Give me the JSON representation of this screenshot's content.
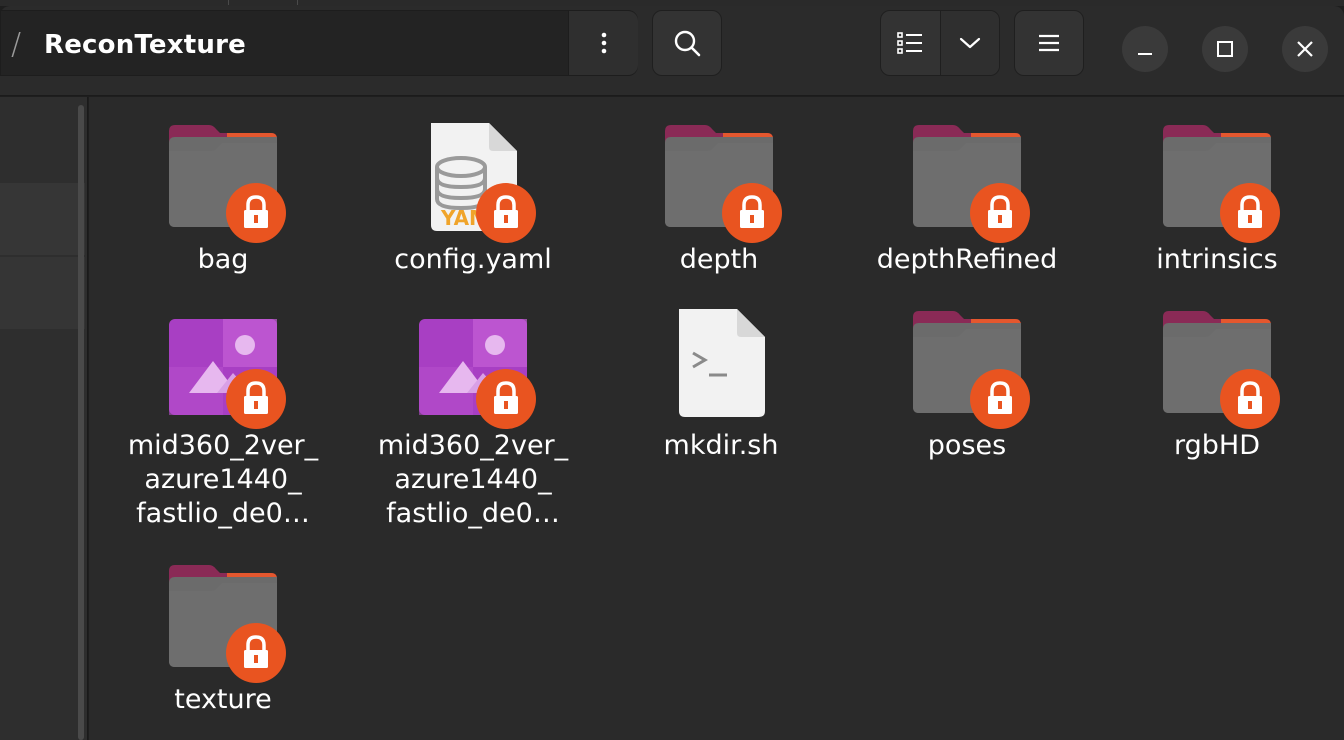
{
  "header": {
    "path_separator": "/",
    "current_folder": "ReconTexture",
    "icons": {
      "path_menu": "vertical-dots-icon",
      "search": "search-icon",
      "list_view": "list-view-icon",
      "view_options": "chevron-down-icon",
      "main_menu": "hamburger-menu-icon",
      "minimize": "minimize-icon",
      "maximize": "maximize-icon",
      "close": "close-icon"
    }
  },
  "files": [
    {
      "name": "bag",
      "type": "folder",
      "locked": true
    },
    {
      "name": "config.yaml",
      "type": "yaml",
      "locked": true
    },
    {
      "name": "depth",
      "type": "folder",
      "locked": true
    },
    {
      "name": "depthRefined",
      "type": "folder",
      "locked": true
    },
    {
      "name": "intrinsics",
      "type": "folder",
      "locked": true
    },
    {
      "name_lines": [
        "mid360_2ver_",
        "azure1440_",
        "fastlio_de0…"
      ],
      "type": "image",
      "locked": true
    },
    {
      "name_lines": [
        "mid360_2ver_",
        "azure1440_",
        "fastlio_de0…"
      ],
      "type": "image",
      "locked": true
    },
    {
      "name": "mkdir.sh",
      "type": "script",
      "locked": true
    },
    {
      "name": "poses",
      "type": "folder",
      "locked": true
    },
    {
      "name": "rgbHD",
      "type": "folder",
      "locked": true
    },
    {
      "name": "texture",
      "type": "folder",
      "locked": true
    }
  ],
  "colors": {
    "accent": "#e95420",
    "folder_body": "#6b6b6b",
    "folder_tab_dark": "#8a2a56",
    "folder_tab_light": "#e4572e",
    "image_icon": "#a83fc3"
  }
}
